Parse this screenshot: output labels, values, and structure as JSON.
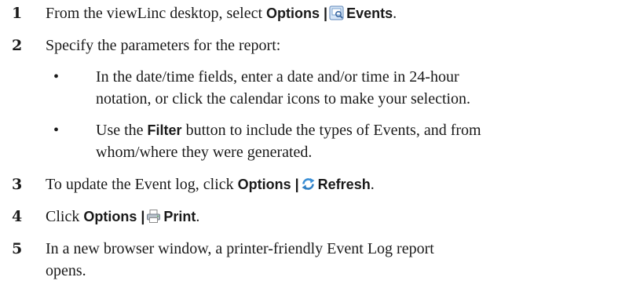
{
  "steps": [
    {
      "number": "1",
      "text": "From the viewLinc desktop, select ",
      "ui_options": "Options |",
      "ui_target": "Events",
      "end": "."
    },
    {
      "number": "2",
      "text": "Specify the parameters for the report:"
    },
    {
      "number": "3",
      "text": "To update the Event log, click ",
      "ui_options": "Options |",
      "ui_target": "Refresh",
      "end": "."
    },
    {
      "number": "4",
      "text": "Click ",
      "ui_options": "Options |",
      "ui_target": "Print",
      "end": "."
    },
    {
      "number": "5",
      "text_line1": "In a new browser window, a printer-friendly Event Log report",
      "text_line2": "opens."
    }
  ],
  "bullets": [
    {
      "line1": "In the date/time fields, enter a date and/or time in 24-hour",
      "line2": "notation, or click the calendar icons to make your selection."
    },
    {
      "line1_pre": "Use the ",
      "line1_ui": "Filter",
      "line1_post": " button to include the types of Events, and from",
      "line2": "whom/where they were generated."
    }
  ],
  "bullet_glyph": "•",
  "icons": [
    "events-icon",
    "refresh-icon",
    "print-icon"
  ]
}
